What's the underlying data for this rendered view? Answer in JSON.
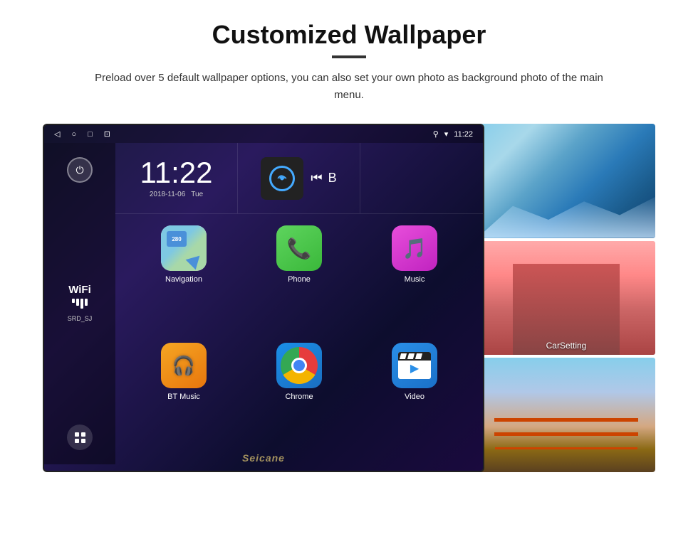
{
  "header": {
    "title": "Customized Wallpaper",
    "description": "Preload over 5 default wallpaper options, you can also set your own photo as background photo of the main menu."
  },
  "status_bar": {
    "time": "11:22",
    "back_icon": "◁",
    "home_icon": "○",
    "recent_icon": "□",
    "screenshot_icon": "⊡",
    "location_icon": "⚲",
    "signal_icon": "▾",
    "time_display": "11:22"
  },
  "clock": {
    "time": "11:22",
    "date": "2018-11-06",
    "day": "Tue"
  },
  "wifi": {
    "label": "WiFi",
    "ssid": "SRD_SJ"
  },
  "apps": [
    {
      "id": "navigation",
      "label": "Navigation",
      "icon_type": "navigation"
    },
    {
      "id": "phone",
      "label": "Phone",
      "icon_type": "phone"
    },
    {
      "id": "music",
      "label": "Music",
      "icon_type": "music"
    },
    {
      "id": "btmusic",
      "label": "BT Music",
      "icon_type": "btmusic"
    },
    {
      "id": "chrome",
      "label": "Chrome",
      "icon_type": "chrome"
    },
    {
      "id": "video",
      "label": "Video",
      "icon_type": "video"
    }
  ],
  "wallpapers": [
    {
      "id": "glacier",
      "type": "glacier"
    },
    {
      "id": "building",
      "type": "building",
      "label": "CarSetting"
    },
    {
      "id": "bridge",
      "type": "bridge"
    }
  ],
  "nav_sign_text": "280",
  "media_controls": {
    "prev": "⏮",
    "letter": "B"
  },
  "watermark": "Seicane"
}
